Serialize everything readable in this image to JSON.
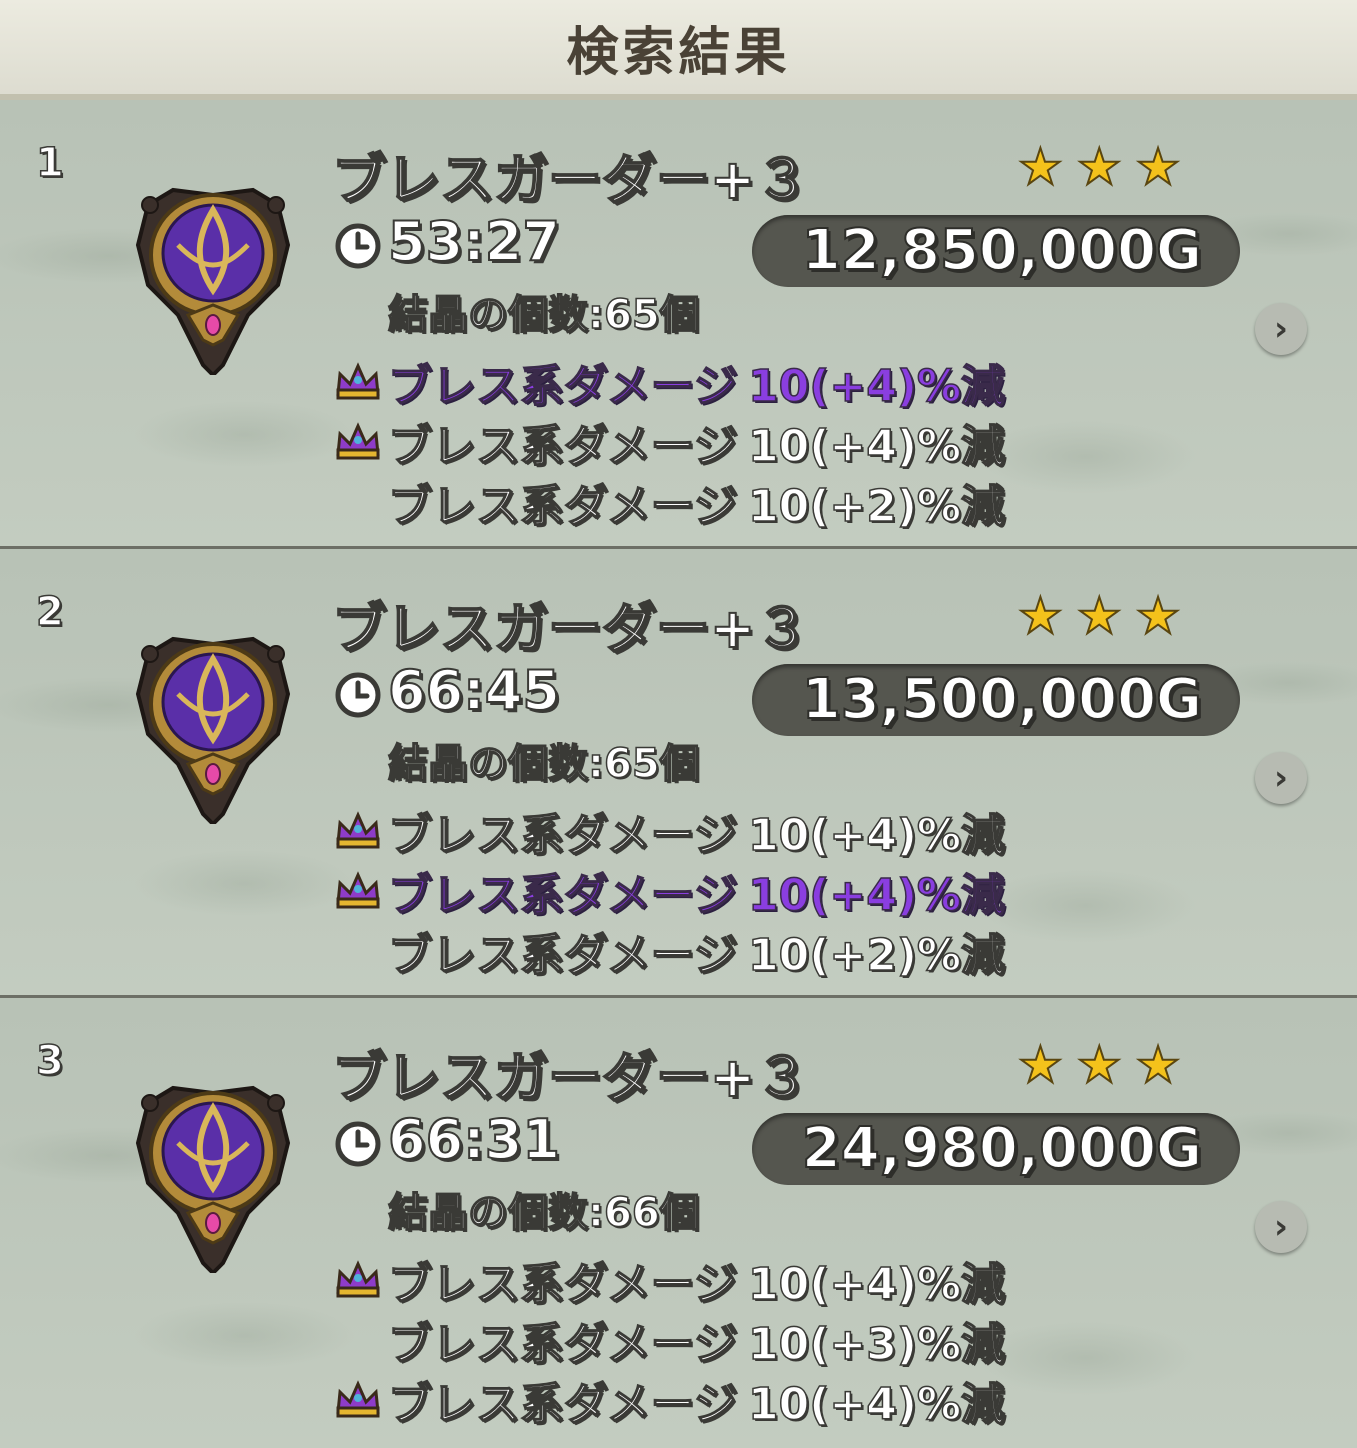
{
  "header": {
    "title": "検索結果"
  },
  "results": [
    {
      "index": "1",
      "name": "ブレスガーダー+３",
      "stars": [
        "★",
        "★",
        "★"
      ],
      "time": "53:27",
      "price": "12,850,000G",
      "crystal": "結晶の個数:65個",
      "stats": [
        {
          "crown": true,
          "highlighted": true,
          "label": "ブレス系ダメージ",
          "value": "10(+4)%減"
        },
        {
          "crown": true,
          "highlighted": false,
          "label": "ブレス系ダメージ",
          "value": "10(+4)%減"
        },
        {
          "crown": false,
          "highlighted": false,
          "label": "ブレス系ダメージ",
          "value": "10(+2)%減"
        }
      ]
    },
    {
      "index": "2",
      "name": "ブレスガーダー+３",
      "stars": [
        "★",
        "★",
        "★"
      ],
      "time": "66:45",
      "price": "13,500,000G",
      "crystal": "結晶の個数:65個",
      "stats": [
        {
          "crown": true,
          "highlighted": false,
          "label": "ブレス系ダメージ",
          "value": "10(+4)%減"
        },
        {
          "crown": true,
          "highlighted": true,
          "label": "ブレス系ダメージ",
          "value": "10(+4)%減"
        },
        {
          "crown": false,
          "highlighted": false,
          "label": "ブレス系ダメージ",
          "value": "10(+2)%減"
        }
      ]
    },
    {
      "index": "3",
      "name": "ブレスガーダー+３",
      "stars": [
        "★",
        "★",
        "★"
      ],
      "time": "66:31",
      "price": "24,980,000G",
      "crystal": "結晶の個数:66個",
      "stats": [
        {
          "crown": true,
          "highlighted": false,
          "label": "ブレス系ダメージ",
          "value": "10(+4)%減"
        },
        {
          "crown": false,
          "highlighted": false,
          "label": "ブレス系ダメージ",
          "value": "10(+3)%減"
        },
        {
          "crown": true,
          "highlighted": false,
          "label": "ブレス系ダメージ",
          "value": "10(+4)%減"
        }
      ]
    }
  ],
  "icons": {
    "item": "brooch-shield-icon",
    "clock": "clock-icon",
    "crown": "crown-icon",
    "star": "star-icon",
    "chevron": "chevron-right-icon"
  },
  "colors": {
    "highlight": "#8a3ee0",
    "star": "#f4c21b",
    "price_pill": "#55564f"
  }
}
